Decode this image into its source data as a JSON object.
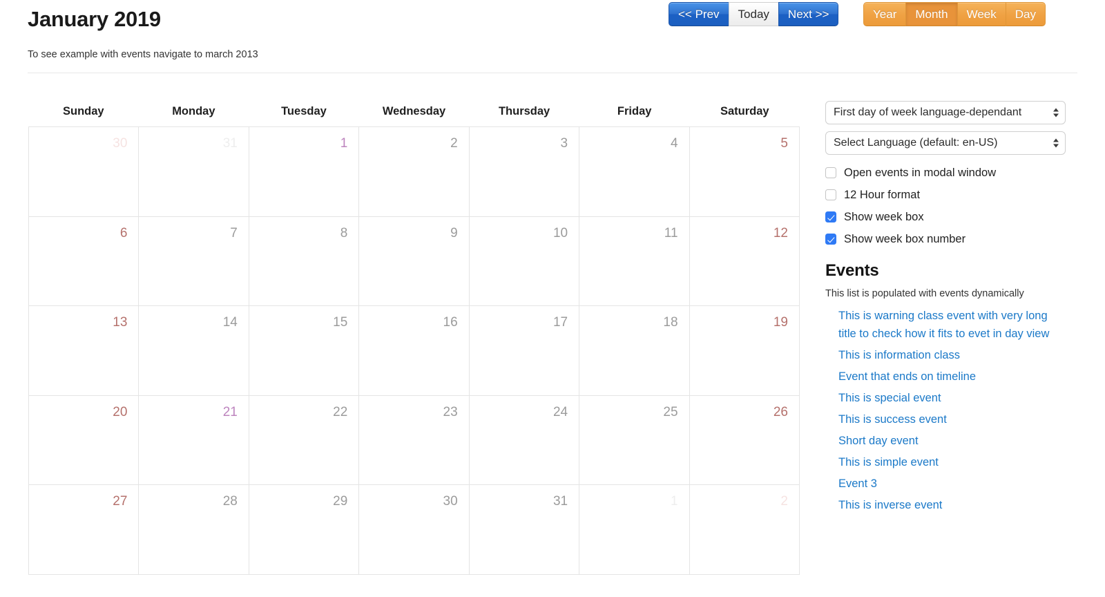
{
  "header": {
    "title": "January 2019",
    "hint": "To see example with events navigate to march 2013"
  },
  "nav_buttons": [
    {
      "label": "<< Prev",
      "name": "prev-button",
      "style": "primary"
    },
    {
      "label": "Today",
      "name": "today-button",
      "style": "default"
    },
    {
      "label": "Next >>",
      "name": "next-button",
      "style": "primary"
    }
  ],
  "view_buttons": [
    {
      "label": "Year",
      "name": "view-year-button",
      "active": false
    },
    {
      "label": "Month",
      "name": "view-month-button",
      "active": true
    },
    {
      "label": "Week",
      "name": "view-week-button",
      "active": false
    },
    {
      "label": "Day",
      "name": "view-day-button",
      "active": false
    }
  ],
  "calendar": {
    "weekdays": [
      "Sunday",
      "Monday",
      "Tuesday",
      "Wednesday",
      "Thursday",
      "Friday",
      "Saturday"
    ],
    "weeks": [
      [
        {
          "day": "30",
          "other_month": true,
          "weekend": true,
          "holiday": false
        },
        {
          "day": "31",
          "other_month": true,
          "weekend": false,
          "holiday": false
        },
        {
          "day": "1",
          "other_month": false,
          "weekend": false,
          "holiday": true
        },
        {
          "day": "2",
          "other_month": false,
          "weekend": false,
          "holiday": false
        },
        {
          "day": "3",
          "other_month": false,
          "weekend": false,
          "holiday": false
        },
        {
          "day": "4",
          "other_month": false,
          "weekend": false,
          "holiday": false
        },
        {
          "day": "5",
          "other_month": false,
          "weekend": true,
          "holiday": false
        }
      ],
      [
        {
          "day": "6",
          "other_month": false,
          "weekend": true,
          "holiday": false
        },
        {
          "day": "7",
          "other_month": false,
          "weekend": false,
          "holiday": false
        },
        {
          "day": "8",
          "other_month": false,
          "weekend": false,
          "holiday": false
        },
        {
          "day": "9",
          "other_month": false,
          "weekend": false,
          "holiday": false
        },
        {
          "day": "10",
          "other_month": false,
          "weekend": false,
          "holiday": false
        },
        {
          "day": "11",
          "other_month": false,
          "weekend": false,
          "holiday": false
        },
        {
          "day": "12",
          "other_month": false,
          "weekend": true,
          "holiday": false
        }
      ],
      [
        {
          "day": "13",
          "other_month": false,
          "weekend": true,
          "holiday": false
        },
        {
          "day": "14",
          "other_month": false,
          "weekend": false,
          "holiday": false
        },
        {
          "day": "15",
          "other_month": false,
          "weekend": false,
          "holiday": false
        },
        {
          "day": "16",
          "other_month": false,
          "weekend": false,
          "holiday": false
        },
        {
          "day": "17",
          "other_month": false,
          "weekend": false,
          "holiday": false
        },
        {
          "day": "18",
          "other_month": false,
          "weekend": false,
          "holiday": false
        },
        {
          "day": "19",
          "other_month": false,
          "weekend": true,
          "holiday": false
        }
      ],
      [
        {
          "day": "20",
          "other_month": false,
          "weekend": true,
          "holiday": false
        },
        {
          "day": "21",
          "other_month": false,
          "weekend": false,
          "holiday": true
        },
        {
          "day": "22",
          "other_month": false,
          "weekend": false,
          "holiday": false
        },
        {
          "day": "23",
          "other_month": false,
          "weekend": false,
          "holiday": false
        },
        {
          "day": "24",
          "other_month": false,
          "weekend": false,
          "holiday": false
        },
        {
          "day": "25",
          "other_month": false,
          "weekend": false,
          "holiday": false
        },
        {
          "day": "26",
          "other_month": false,
          "weekend": true,
          "holiday": false
        }
      ],
      [
        {
          "day": "27",
          "other_month": false,
          "weekend": true,
          "holiday": false
        },
        {
          "day": "28",
          "other_month": false,
          "weekend": false,
          "holiday": false
        },
        {
          "day": "29",
          "other_month": false,
          "weekend": false,
          "holiday": false
        },
        {
          "day": "30",
          "other_month": false,
          "weekend": false,
          "holiday": false
        },
        {
          "day": "31",
          "other_month": false,
          "weekend": false,
          "holiday": false
        },
        {
          "day": "1",
          "other_month": true,
          "weekend": false,
          "holiday": false
        },
        {
          "day": "2",
          "other_month": true,
          "weekend": true,
          "holiday": false
        }
      ]
    ]
  },
  "sidebar": {
    "selects": [
      {
        "name": "first-day-of-week-select",
        "value": "First day of week language-dependant"
      },
      {
        "name": "language-select",
        "value": "Select Language (default: en-US)"
      }
    ],
    "checkboxes": [
      {
        "name": "open-events-in-modal-checkbox",
        "label": "Open events in modal window",
        "checked": false
      },
      {
        "name": "12-hour-format-checkbox",
        "label": "12 Hour format",
        "checked": false
      },
      {
        "name": "show-week-box-checkbox",
        "label": "Show week box",
        "checked": true
      },
      {
        "name": "show-week-box-number-checkbox",
        "label": "Show week box number",
        "checked": true
      }
    ],
    "events": {
      "heading": "Events",
      "subtitle": "This list is populated with events dynamically",
      "items": [
        "This is warning class event with very long title to check how it fits to evet in day view",
        "This is information class",
        "Event that ends on timeline",
        "This is special event",
        "This is success event",
        "Short day event",
        "This is simple event",
        "Event 3",
        "This is inverse event"
      ]
    }
  },
  "colors": {
    "primary_blue": "#2f72cf",
    "warning_orange": "#efa143",
    "warning_orange_active": "#e8933a",
    "weekend_red": "#b5716c",
    "holiday_purple": "#bd84be",
    "link_blue": "#1b79c8",
    "grid_border": "#e4e4e4",
    "checkbox_checked": "#2f7af5"
  }
}
